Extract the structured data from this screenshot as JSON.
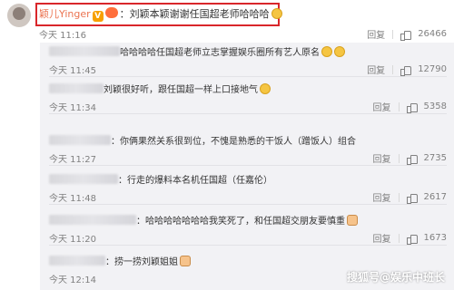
{
  "main_comment": {
    "author": "颖儿Yinger",
    "text": "：刘颖本颖谢谢任国超老师哈哈哈",
    "time": "今天 11:16",
    "reply_label": "回复",
    "likes": "26466"
  },
  "replies": [
    {
      "text": "哈哈哈哈任国超老师立志掌握娱乐圈所有艺人原名",
      "time": "今天 11:45",
      "reply_label": "回复",
      "likes": "12790"
    },
    {
      "text": "刘颖很好听，跟任国超一样上口接地气",
      "time": "今天 11:34",
      "reply_label": "回复",
      "likes": "5358"
    },
    {
      "text": "：你俩果然关系很到位，不愧是熟悉的干饭人（蹭饭人）组合",
      "time": "今天 11:27",
      "reply_label": "回复",
      "likes": "2735"
    },
    {
      "text": "：行走的爆料本名机任国超（任嘉伦）",
      "time": "今天 11:48",
      "reply_label": "回复",
      "likes": "2617"
    },
    {
      "text": "：哈哈哈哈哈哈哈我笑死了，和任国超交朋友要慎重",
      "time": "今天 11:20",
      "reply_label": "回复",
      "likes": "1673"
    },
    {
      "text": "：捞一捞刘颖姐姐",
      "time": "今天 12:14",
      "reply_label": "",
      "likes": ""
    }
  ],
  "watermark": "搜狐号@娱乐中班长",
  "colors": {
    "author": "#eb7350",
    "highlight_border": "#d9262b",
    "reply_bg": "#f2f2f5",
    "meta": "#808080"
  }
}
